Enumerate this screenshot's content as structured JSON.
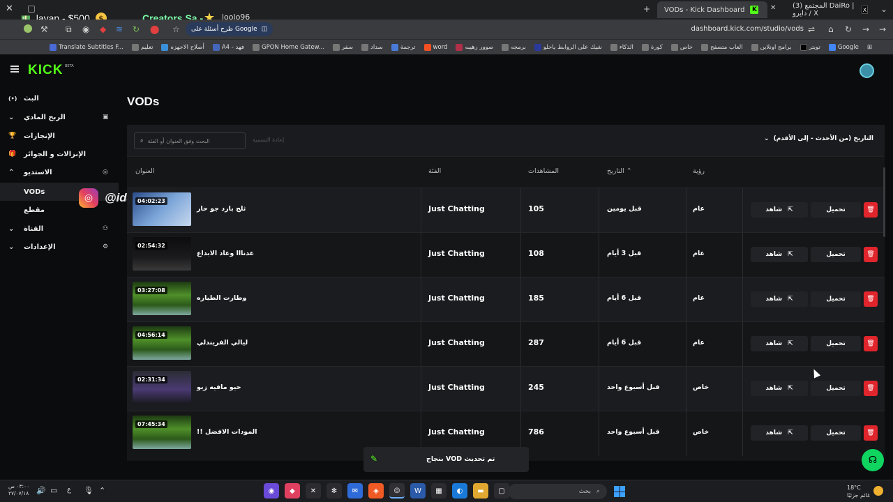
{
  "browser": {
    "tabs": [
      {
        "label": "VODs - Kick Dashboard",
        "active": true
      },
      {
        "label": "(3) المجتمع DaiRo | دايرو / X",
        "active": false
      }
    ],
    "url": "dashboard.kick.com/studio/vods",
    "ask_pill": "طرح أسئلة على Google",
    "bookmarks": [
      "Google",
      "تويتر",
      "برامج اونلاين",
      "العاب متصفح",
      "خاص",
      "كورة",
      "الذكاء",
      "شيك على الروابط ياحلو",
      "برمجه",
      "صوور رهيبه",
      "word",
      "ترجمة",
      "سداد",
      "سفر",
      "GPON Home Gatew...",
      "A4 - فهد",
      "أصلاح الاجهزه",
      "تعليم",
      "Translate Subtitles F..."
    ]
  },
  "overlay": {
    "money": "layan - $500",
    "creator": "Creators Sa -",
    "username": "loolo96",
    "insta_handle": "@ida"
  },
  "app": {
    "logo": "KICK",
    "beta": "BETA",
    "sidebar": [
      {
        "label": "البث",
        "icon": "(•)",
        "chevron": false
      },
      {
        "label": "الربح المادي",
        "icon": "▣",
        "chevron": true
      },
      {
        "label": "الإنجازات",
        "icon": "🏆",
        "chevron": false
      },
      {
        "label": "الإنزالات و الجوائز",
        "icon": "🎁",
        "chevron": false
      },
      {
        "label": "الاستديو",
        "icon": "◎",
        "chevron": true,
        "expanded": true
      },
      {
        "label": "VODs",
        "icon": "",
        "chevron": false,
        "sub": true,
        "active": true
      },
      {
        "label": "مقطع",
        "icon": "",
        "chevron": false,
        "sub": true
      },
      {
        "label": "القناة",
        "icon": "⚇",
        "chevron": true
      },
      {
        "label": "الإعدادات",
        "icon": "⚙",
        "chevron": true
      }
    ],
    "page_title": "VODs",
    "search_placeholder": "البحث وفق العنوان أو الفئة",
    "edit_label": "إعادة التسمية",
    "sort_label": "التاريخ (من الأحدث - إلى الأقدم)",
    "columns": {
      "title": "العنوان",
      "category": "الفئة",
      "views": "المشاهدات",
      "date": "التاريخ",
      "visibility": "رؤية"
    },
    "rows": [
      {
        "duration": "04:02:23",
        "title": "ثلج بارد جو حار",
        "category": "Just Chatting",
        "views": "105",
        "date": "قبل يومين",
        "visibility": "عام",
        "thumb": "game"
      },
      {
        "duration": "02:54:32",
        "title": "عدنااا وعاد الابداع",
        "category": "Just Chatting",
        "views": "108",
        "date": "قبل 3 أيام",
        "visibility": "عام",
        "thumb": "dark"
      },
      {
        "duration": "03:27:08",
        "title": "وطارت الطياره",
        "category": "Just Chatting",
        "views": "185",
        "date": "قبل 6 أيام",
        "visibility": "عام",
        "thumb": "forest"
      },
      {
        "duration": "04:56:14",
        "title": "ليالي الفريندلي",
        "category": "Just Chatting",
        "views": "287",
        "date": "قبل 6 أيام",
        "visibility": "عام",
        "thumb": "forest"
      },
      {
        "duration": "02:31:34",
        "title": "حيو مافيه زيو",
        "category": "Just Chatting",
        "views": "245",
        "date": "قبل أسبوع واحد",
        "visibility": "خاص",
        "thumb": "screen"
      },
      {
        "duration": "07:45:34",
        "title": "!! المودات الافضل",
        "category": "Just Chatting",
        "views": "786",
        "date": "قبل أسبوع واحد",
        "visibility": "خاص",
        "thumb": "forest"
      }
    ],
    "watch_label": "شاهد",
    "download_label": "تحميل",
    "toast": "بنجاح VOD تم تحديث"
  },
  "taskbar": {
    "search_label": "بحث",
    "weather_temp": "18°C",
    "weather_desc": "غائم جزئيًا",
    "time": "٠٣:٠٠ ص",
    "date": "٢٧/٠٧/١٨",
    "lang": "ع"
  },
  "colors": {
    "accent": "#53fc18",
    "danger": "#e0252c",
    "bg": "#0b0c0d"
  }
}
